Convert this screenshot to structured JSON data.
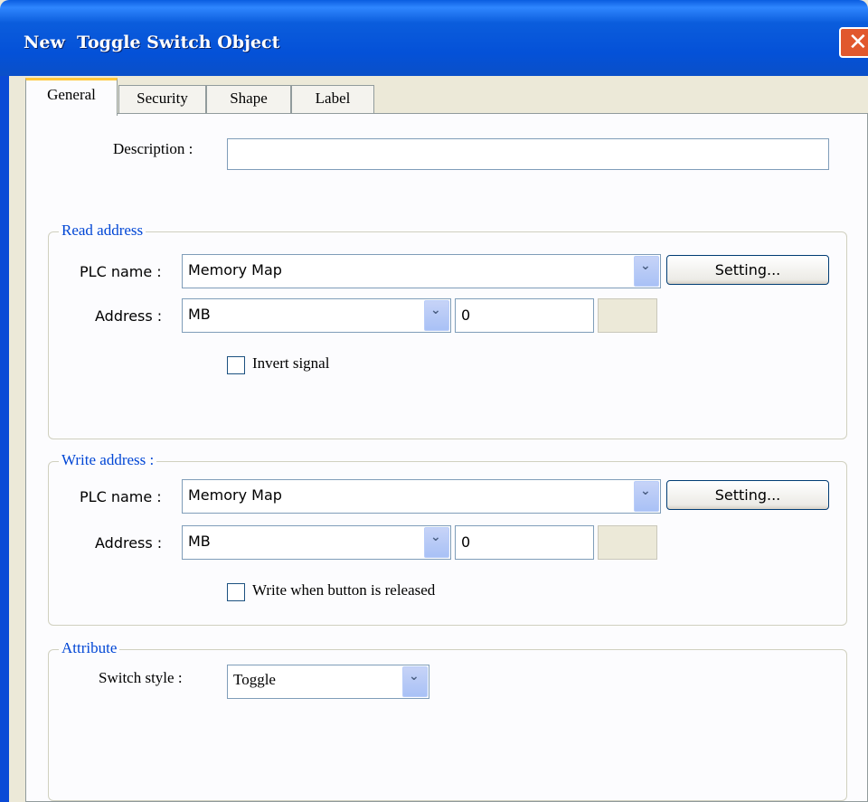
{
  "window": {
    "title": "New  Toggle Switch Object"
  },
  "tabs": [
    {
      "label": "General"
    },
    {
      "label": "Security"
    },
    {
      "label": "Shape"
    },
    {
      "label": "Label"
    }
  ],
  "general": {
    "description_label": "Description :",
    "description_value": ""
  },
  "read_address": {
    "title": "Read address",
    "plc_label": "PLC name :",
    "plc_value": "Memory Map",
    "setting_label": "Setting...",
    "address_label": "Address :",
    "address_type": "MB",
    "address_value": "0",
    "invert_label": "Invert signal",
    "invert_checked": false
  },
  "write_address": {
    "title": "Write address :",
    "plc_label": "PLC name :",
    "plc_value": "Memory Map",
    "setting_label": "Setting...",
    "address_label": "Address :",
    "address_type": "MB",
    "address_value": "0",
    "release_label": "Write when button is released",
    "release_checked": false
  },
  "attribute": {
    "title": "Attribute",
    "switch_style_label": "Switch style :",
    "switch_style_value": "Toggle"
  },
  "icons": {
    "close": "close-icon",
    "dropdown": "chevron-down-icon"
  }
}
